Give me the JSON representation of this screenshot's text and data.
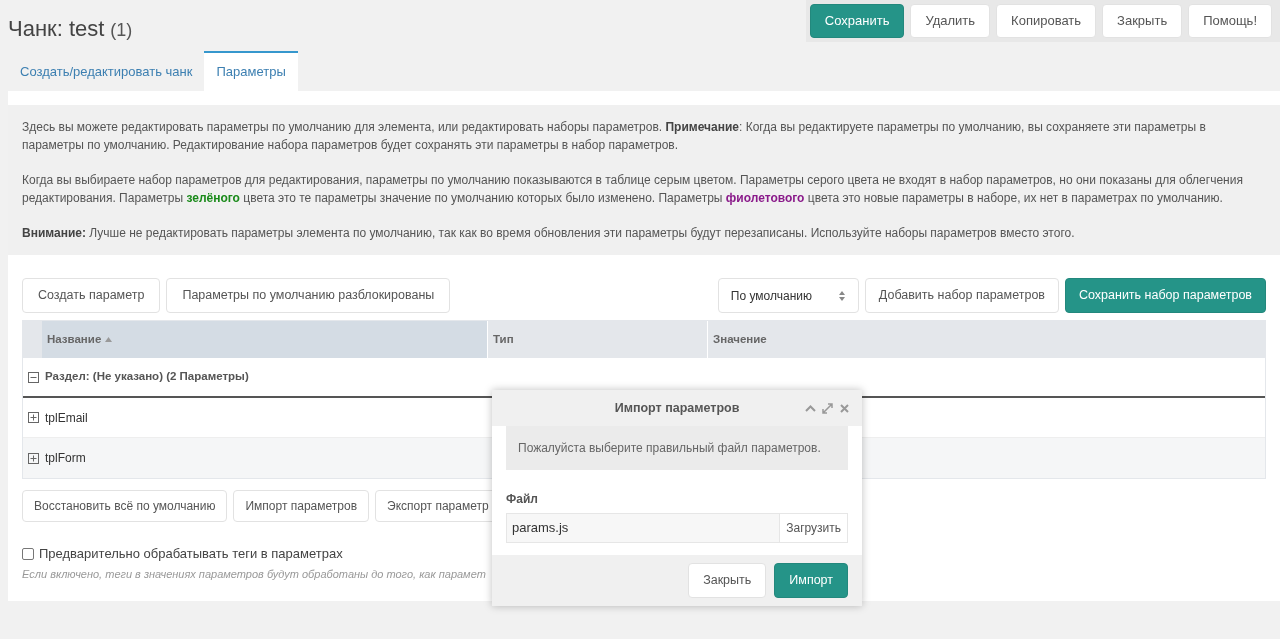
{
  "header": {
    "title": "Чанк: test",
    "count": "(1)"
  },
  "actions": [
    {
      "label": "Сохранить",
      "primary": true
    },
    {
      "label": "Удалить",
      "primary": false
    },
    {
      "label": "Копировать",
      "primary": false
    },
    {
      "label": "Закрыть",
      "primary": false
    },
    {
      "label": "Помощь!",
      "primary": false
    }
  ],
  "tabs": [
    {
      "label": "Создать/редактировать чанк",
      "selected": false
    },
    {
      "label": "Параметры",
      "selected": true
    }
  ],
  "description": [
    "Здесь вы можете редактировать параметры по умолчанию для элемента, или редактировать наборы параметров. **Примечание**: Когда вы редактируете параметры по умолчанию, вы сохраняете эти параметры в параметры по умолчанию. Редактирование набора параметров будет сохранять эти параметры в набор параметров.",
    "Когда вы выбираете набор параметров для редактирования, параметры по умолчанию показываются в таблице серым цветом. Параметры серого цвета не входят в набор параметров, но они показаны для облегчения редактирования. Параметры **зелёного** цвета это те параметры значение по умолчанию которых было изменено. Параметры **фиолетового** цвета это новые параметры в наборе, их нет в параметрах по умолчанию.",
    "**Внимание:** Лучше не редактировать параметры элемента по умолчанию, так как во время обновления эти параметры будут перезаписаны. Используйте наборы параметров вместо этого."
  ],
  "toolbar": {
    "left_buttons": [
      "Создать параметр",
      "Параметры по умолчанию разблокированы"
    ],
    "set_select": {
      "value": "По умолчанию"
    },
    "right_buttons": [
      {
        "label": "Добавить набор параметров",
        "primary": false
      },
      {
        "label": "Сохранить набор параметров",
        "primary": true
      }
    ]
  },
  "table": {
    "columns": [
      {
        "label": "Название",
        "sorted": true
      },
      {
        "label": "Тип",
        "sorted": false
      },
      {
        "label": "Значение",
        "sorted": false
      }
    ],
    "group": {
      "label": "Раздел: (Не указано) (2 Параметры)",
      "expanded": true
    },
    "rows": [
      {
        "name": "tplEmail",
        "expanded": false
      },
      {
        "name": "tplForm",
        "expanded": false
      }
    ]
  },
  "bottom_buttons": [
    "Восстановить всё по умолчанию",
    "Импорт параметров",
    "Экспорт параметр"
  ],
  "preprocess": {
    "label": "Предварительно обрабатывать теги в параметрах",
    "checked": false,
    "hint": "Если включено, теги в значениях параметров будут обработаны до того, как парамет"
  },
  "dialog": {
    "title": "Импорт параметров",
    "message": "Пожалуйста выберите правильный файл параметров.",
    "file_label": "Файл",
    "file_value": "params.js",
    "upload": "Загрузить",
    "buttons": [
      {
        "label": "Закрыть",
        "primary": false
      },
      {
        "label": "Импорт",
        "primary": true
      }
    ]
  }
}
